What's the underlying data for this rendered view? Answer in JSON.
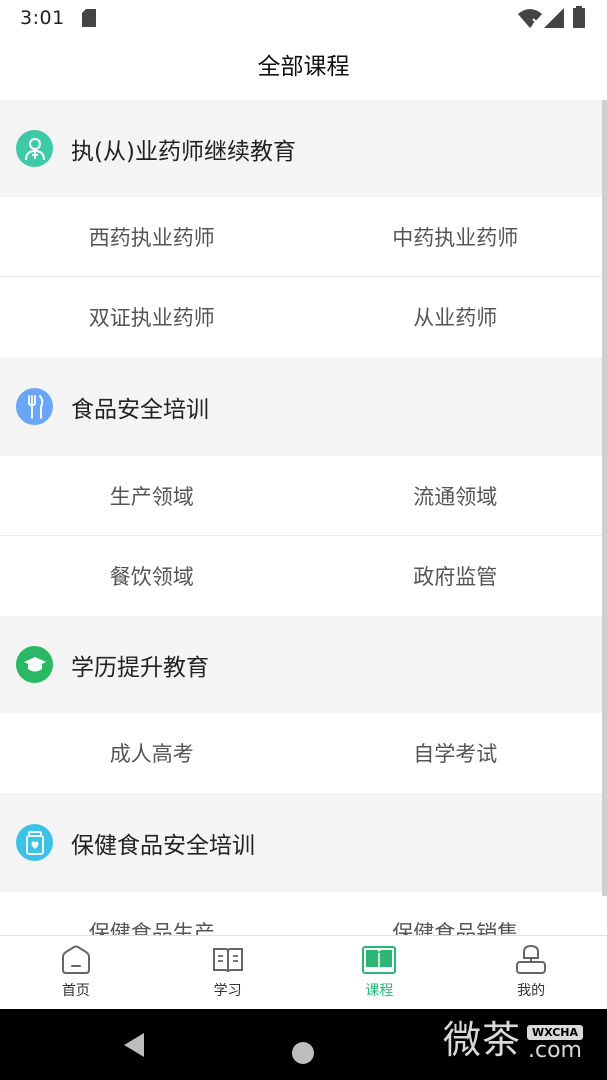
{
  "status_bar": {
    "time": "3:01"
  },
  "header": {
    "title": "全部课程"
  },
  "categories": [
    {
      "title": "执(从)业药师继续教育",
      "icon": "pharmacist-icon",
      "color": "#3ec9a7",
      "rows": [
        [
          "西药执业药师",
          "中药执业药师"
        ],
        [
          "双证执业药师",
          "从业药师"
        ]
      ]
    },
    {
      "title": "食品安全培训",
      "icon": "fork-knife-icon",
      "color": "#6aa6f5",
      "rows": [
        [
          "生产领域",
          "流通领域"
        ],
        [
          "餐饮领域",
          "政府监管"
        ]
      ]
    },
    {
      "title": "学历提升教育",
      "icon": "graduation-cap-icon",
      "color": "#2bb865",
      "rows": [
        [
          "成人高考",
          "自学考试"
        ]
      ]
    },
    {
      "title": "保健食品安全培训",
      "icon": "health-food-icon",
      "color": "#3cc2e6",
      "rows": [
        [
          "保健食品生产",
          "保健食品销售"
        ]
      ]
    }
  ],
  "bottom_nav": [
    {
      "label": "首页",
      "icon": "home-icon",
      "active": false
    },
    {
      "label": "学习",
      "icon": "book-open-icon",
      "active": false
    },
    {
      "label": "课程",
      "icon": "course-book-icon",
      "active": true
    },
    {
      "label": "我的",
      "icon": "profile-icon",
      "active": false
    }
  ],
  "colors": {
    "accent": "#2bb673",
    "icon_gray": "#666666"
  },
  "watermark": {
    "chars": "微茶",
    "tag": "WXCHA",
    "domain": ".com"
  }
}
